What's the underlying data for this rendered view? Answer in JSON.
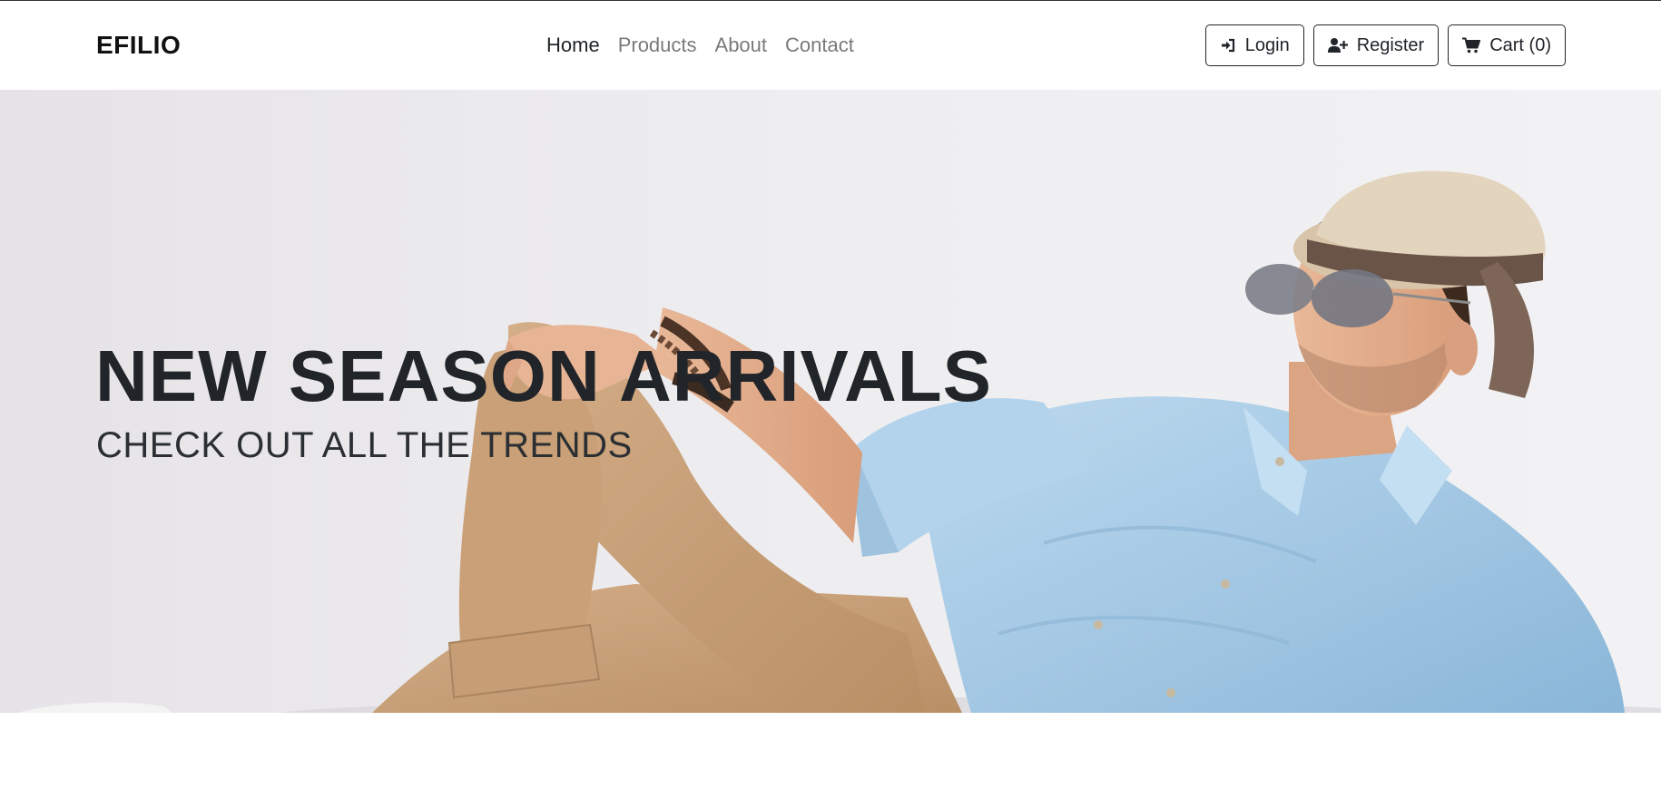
{
  "brand": {
    "name": "EFILIO"
  },
  "nav": {
    "links": [
      {
        "label": "Home",
        "active": true
      },
      {
        "label": "Products",
        "active": false
      },
      {
        "label": "About",
        "active": false
      },
      {
        "label": "Contact",
        "active": false
      }
    ]
  },
  "actions": {
    "login": {
      "label": "Login",
      "icon": "sign-in-icon"
    },
    "register": {
      "label": "Register",
      "icon": "user-plus-icon"
    },
    "cart": {
      "label": "Cart (0)",
      "icon": "shopping-cart-icon"
    }
  },
  "hero": {
    "title": "NEW SEASON ARRIVALS",
    "subtitle": "CHECK OUT ALL THE TRENDS",
    "image_subject": "man-in-hat-sunglasses-denim-shirt-reclining"
  },
  "colors": {
    "text": "#212529",
    "nav_inactive": "#7a7a7a",
    "shirt": "#a8cbe6",
    "pants": "#c8a078",
    "hero_bg": "#eceaee"
  }
}
